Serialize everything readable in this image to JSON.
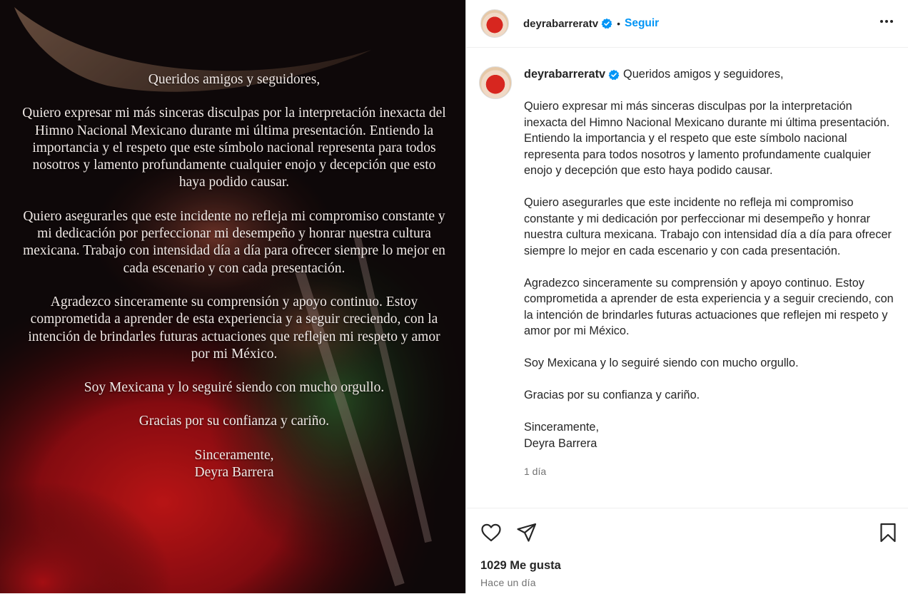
{
  "post": {
    "username": "deyrabarreratv",
    "follow_label": "Seguir",
    "separator": "•",
    "image_text": [
      "Queridos amigos y seguidores,",
      "Quiero expresar mi más sinceras disculpas por la interpretación inexacta del Himno Nacional Mexicano durante mi última presentación. Entiendo la importancia y el respeto que este símbolo nacional representa para todos nosotros y lamento profundamente cualquier enojo y decepción que esto haya podido causar.",
      "Quiero asegurarles que este incidente no refleja mi compromiso constante y mi dedicación por perfeccionar mi desempeño y honrar nuestra cultura mexicana. Trabajo con intensidad día a día para ofrecer siempre lo mejor en cada escenario y con cada presentación.",
      "Agradezco sinceramente su comprensión y apoyo continuo. Estoy comprometida a aprender de esta experiencia y a seguir creciendo, con la intención de brindarles futuras actuaciones que reflejen mi respeto y amor por mi México.",
      "Soy Mexicana y lo seguiré siendo con mucho orgullo.",
      "Gracias por su confianza y cariño.",
      "Sinceramente,\nDeyra Barrera"
    ],
    "caption": {
      "first_line": "Queridos amigos y seguidores,",
      "paragraphs": [
        "Quiero expresar mi más sinceras disculpas por la interpretación inexacta del Himno Nacional Mexicano durante mi última presentación. Entiendo la importancia y el respeto que este símbolo nacional representa para todos nosotros y lamento profundamente cualquier enojo y decepción que esto haya podido causar.",
        "Quiero asegurarles que este incidente no refleja mi compromiso constante y mi dedicación por perfeccionar mi desempeño y honrar nuestra cultura mexicana. Trabajo con intensidad día a día para ofrecer siempre lo mejor en cada escenario y con cada presentación.",
        "Agradezco sinceramente su comprensión y apoyo continuo. Estoy comprometida a aprender de esta experiencia y a seguir creciendo, con la intención de brindarles futuras actuaciones que reflejen mi respeto y amor por mi México.",
        "Soy Mexicana y lo seguiré siendo con mucho orgullo.",
        "Gracias por su confianza y cariño."
      ],
      "signoff": "Sinceramente,",
      "signature": "Deyra Barrera",
      "time": "1 día"
    },
    "likes_label": "1029 Me gusta",
    "posted_ago": "Hace un día",
    "icons": [
      "verified-badge-icon",
      "more-options-icon",
      "heart-icon",
      "share-icon",
      "bookmark-icon"
    ],
    "colors": {
      "link": "#0095f6",
      "verified": "#0095f6",
      "muted": "#737373"
    }
  }
}
